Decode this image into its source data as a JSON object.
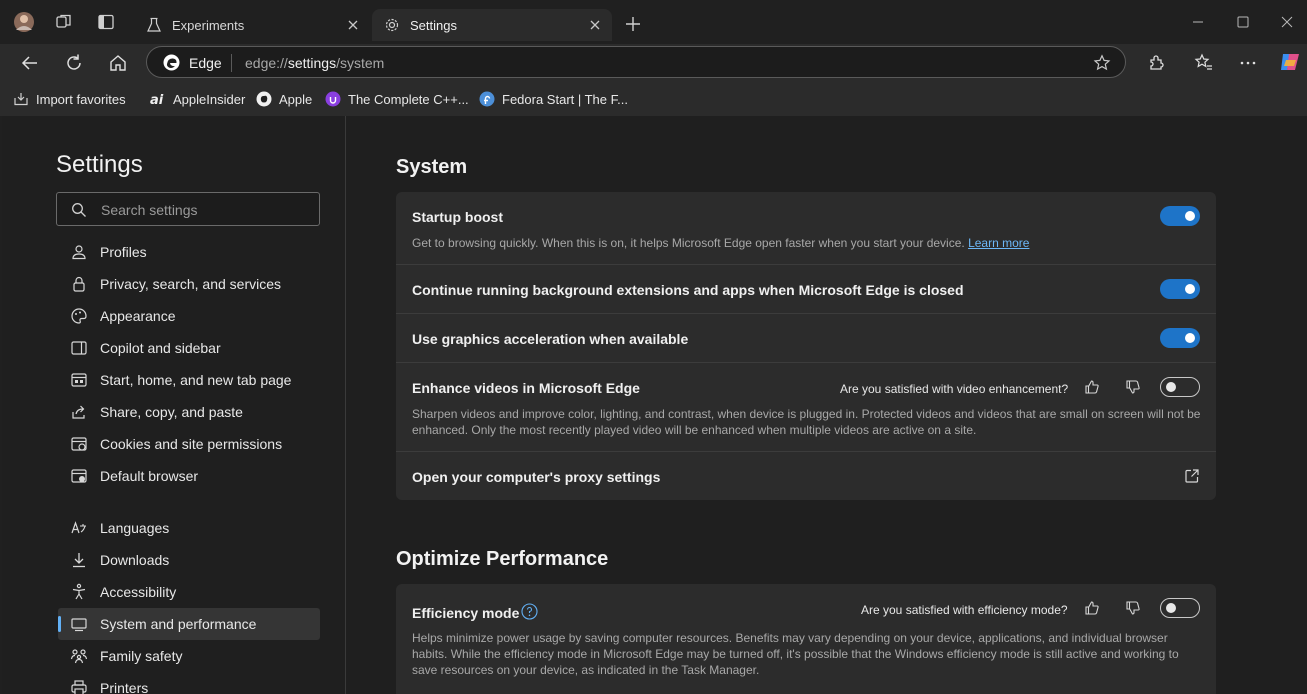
{
  "tabs": [
    {
      "label": "Experiments",
      "icon": "flask-icon"
    },
    {
      "label": "Settings",
      "icon": "gear-icon"
    }
  ],
  "address_bar": {
    "site_label": "Edge",
    "url_prefix": "edge://",
    "url_highlight": "settings",
    "url_suffix": "/system"
  },
  "bookmarks": [
    {
      "label": "Import favorites",
      "icon": "import-icon"
    },
    {
      "label": "AppleInsider",
      "icon": "appleinsider-icon"
    },
    {
      "label": "Apple",
      "icon": "apple-icon"
    },
    {
      "label": "The Complete C++...",
      "icon": "udemy-icon"
    },
    {
      "label": "Fedora Start | The F...",
      "icon": "fedora-icon"
    }
  ],
  "sidebar": {
    "title": "Settings",
    "search_placeholder": "Search settings",
    "items": [
      {
        "label": "Profiles",
        "icon": "profile-icon"
      },
      {
        "label": "Privacy, search, and services",
        "icon": "lock-icon"
      },
      {
        "label": "Appearance",
        "icon": "palette-icon"
      },
      {
        "label": "Copilot and sidebar",
        "icon": "sidebar-icon"
      },
      {
        "label": "Start, home, and new tab page",
        "icon": "home-page-icon"
      },
      {
        "label": "Share, copy, and paste",
        "icon": "share-icon"
      },
      {
        "label": "Cookies and site permissions",
        "icon": "cookies-icon"
      },
      {
        "label": "Default browser",
        "icon": "browser-icon"
      },
      {
        "label": "Languages",
        "icon": "languages-icon"
      },
      {
        "label": "Downloads",
        "icon": "download-icon"
      },
      {
        "label": "Accessibility",
        "icon": "accessibility-icon"
      },
      {
        "label": "System and performance",
        "icon": "computer-icon",
        "active": true
      },
      {
        "label": "Family safety",
        "icon": "family-icon"
      },
      {
        "label": "Printers",
        "icon": "printer-icon"
      }
    ]
  },
  "system": {
    "title": "System",
    "rows": [
      {
        "title": "Startup boost",
        "description": "Get to browsing quickly. When this is on, it helps Microsoft Edge open faster when you start your device.",
        "link": "Learn more",
        "enabled": true
      },
      {
        "title": "Continue running background extensions and apps when Microsoft Edge is closed",
        "enabled": true
      },
      {
        "title": "Use graphics acceleration when available",
        "enabled": true
      },
      {
        "title": "Enhance videos in Microsoft Edge",
        "feedback": "Are you satisfied with video enhancement?",
        "description": "Sharpen videos and improve color, lighting, and contrast, when device is plugged in. Protected videos and videos that are small on screen will not be enhanced. Only the most recently played video will be enhanced when multiple videos are active on a site.",
        "enabled": false
      },
      {
        "title": "Open your computer's proxy settings"
      }
    ]
  },
  "performance": {
    "title": "Optimize Performance",
    "rows": [
      {
        "title": "Efficiency mode",
        "feedback": "Are you satisfied with efficiency mode?",
        "description": "Helps minimize power usage by saving computer resources. Benefits may vary depending on your device, applications, and individual browser habits. While the efficiency mode in Microsoft Edge may be turned off, it's possible that the Windows efficiency mode is still active and working to save resources on your device, as indicated in the Task Manager.",
        "enabled": false
      }
    ]
  },
  "colors": {
    "accent": "#1e74c8",
    "link": "#6cb7f7",
    "active_indicator": "#62b0f5"
  }
}
